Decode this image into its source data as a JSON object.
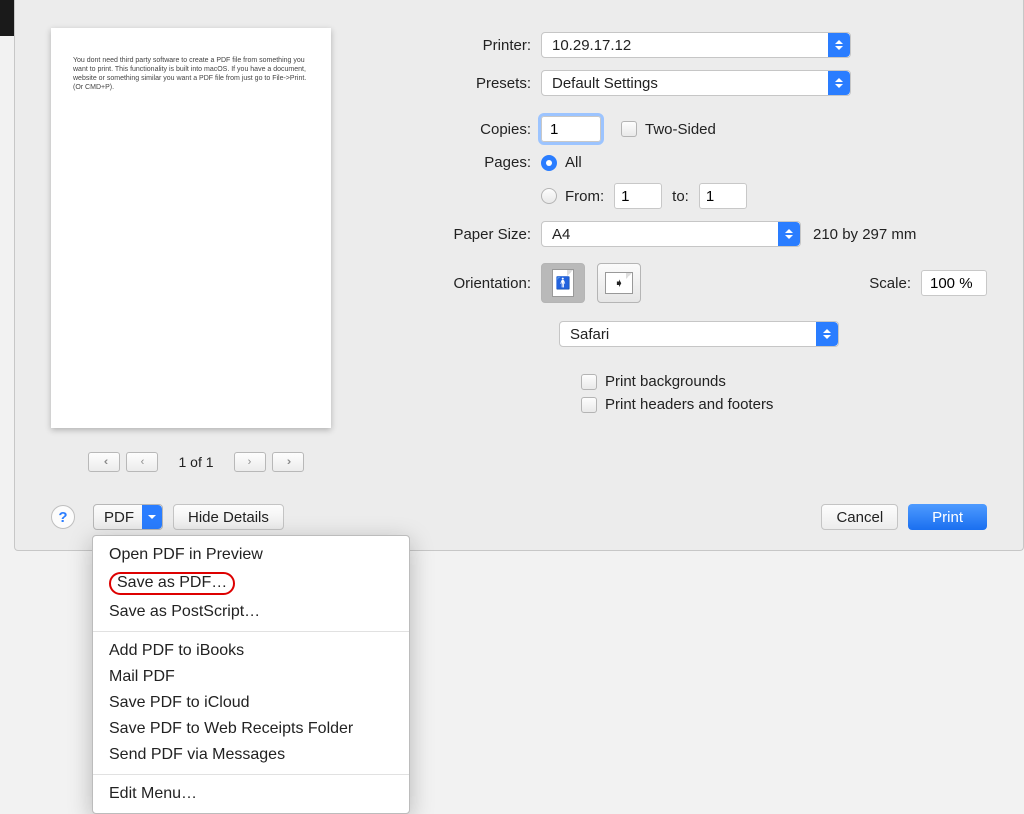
{
  "preview_text": "You dont need third party software to create a PDF file from something you want to print. This functionality is built into macOS. If you have a document, website or something similar you want a PDF file from just go to File->Print. (Or CMD+P).",
  "pager": {
    "label": "1 of 1"
  },
  "labels": {
    "printer": "Printer:",
    "presets": "Presets:",
    "copies": "Copies:",
    "two_sided": "Two-Sided",
    "pages": "Pages:",
    "all": "All",
    "from": "From:",
    "to": "to:",
    "paper_size": "Paper Size:",
    "orientation": "Orientation:",
    "scale": "Scale:",
    "print_backgrounds": "Print backgrounds",
    "print_headers": "Print headers and footers"
  },
  "values": {
    "printer": "10.29.17.12",
    "preset": "Default Settings",
    "copies": "1",
    "from": "1",
    "to": "1",
    "paper_size": "A4",
    "paper_note": "210 by 297 mm",
    "scale": "100 %",
    "app_options": "Safari"
  },
  "footer": {
    "pdf": "PDF",
    "hide_details": "Hide Details",
    "cancel": "Cancel",
    "print": "Print"
  },
  "pdf_menu": {
    "open_preview": "Open PDF in Preview",
    "save_pdf": "Save as PDF…",
    "save_ps": "Save as PostScript…",
    "add_ibooks": "Add PDF to iBooks",
    "mail": "Mail PDF",
    "icloud": "Save PDF to iCloud",
    "web_receipts": "Save PDF to Web Receipts Folder",
    "messages": "Send PDF via Messages",
    "edit": "Edit Menu…"
  }
}
